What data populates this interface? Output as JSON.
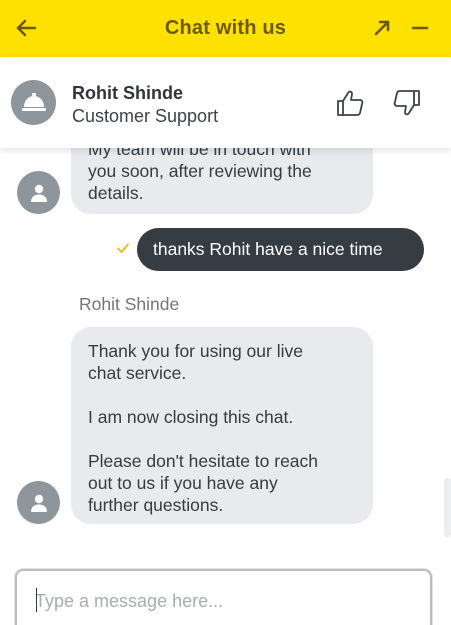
{
  "header": {
    "title": "Chat with us",
    "icons": [
      "arrow-left-icon",
      "arrow-up-right-icon",
      "minus-icon"
    ]
  },
  "agent": {
    "name": "Rohit Shinde",
    "role": "Customer Support",
    "avatar_icon": "bell-icon",
    "rating_icons": [
      "thumbs-up-icon",
      "thumbs-down-icon"
    ]
  },
  "messages": [
    {
      "from": "agent",
      "lines": [
        "My team will be in touch with",
        "you soon, after reviewing the",
        "details."
      ]
    },
    {
      "from": "user",
      "text": "thanks Rohit have a nice time",
      "status_icon": "check-icon"
    },
    {
      "from": "agent",
      "sender": "Rohit Shinde",
      "paragraphs": [
        [
          "Thank you for using our live",
          "chat service."
        ],
        [
          "I am now closing this chat."
        ],
        [
          "Please don't hesitate to reach",
          "out to us if you have any",
          "further questions."
        ]
      ]
    }
  ],
  "composer": {
    "placeholder": "Type a message here...",
    "value": ""
  },
  "colors": {
    "header_bg": "#ffe100",
    "header_text": "#6b5a00",
    "agent_bubble": "#e8eaed",
    "user_bubble": "#353c42",
    "check": "#e6c200",
    "avatar": "#8e959b"
  }
}
